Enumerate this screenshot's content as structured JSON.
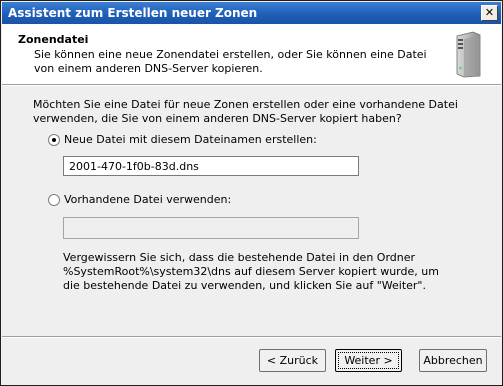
{
  "window": {
    "title": "Assistent zum Erstellen neuer Zonen"
  },
  "header": {
    "title": "Zonendatei",
    "description": "Sie können eine neue Zonendatei erstellen, oder Sie können eine Datei von einem anderen DNS-Server kopieren.",
    "icon": "server-icon"
  },
  "main": {
    "question": "Möchten Sie eine Datei für neue Zonen erstellen oder eine vorhandene Datei verwenden, die Sie von einem anderen DNS-Server kopiert haben?",
    "option_new": {
      "label": "Neue Datei mit diesem Dateinamen erstellen:",
      "selected": true
    },
    "filename_value": "2001-470-1f0b-83d.dns",
    "option_existing": {
      "label": "Vorhandene Datei verwenden:",
      "selected": false
    },
    "existing_value": "",
    "note": "Vergewissern Sie sich, dass die bestehende Datei in den Ordner %SystemRoot%\\system32\\dns auf diesem Server kopiert wurde, um die bestehende Datei zu verwenden, und klicken Sie auf \"Weiter\"."
  },
  "buttons": {
    "back": "< Zurück",
    "next": "Weiter >",
    "cancel": "Abbrechen"
  }
}
